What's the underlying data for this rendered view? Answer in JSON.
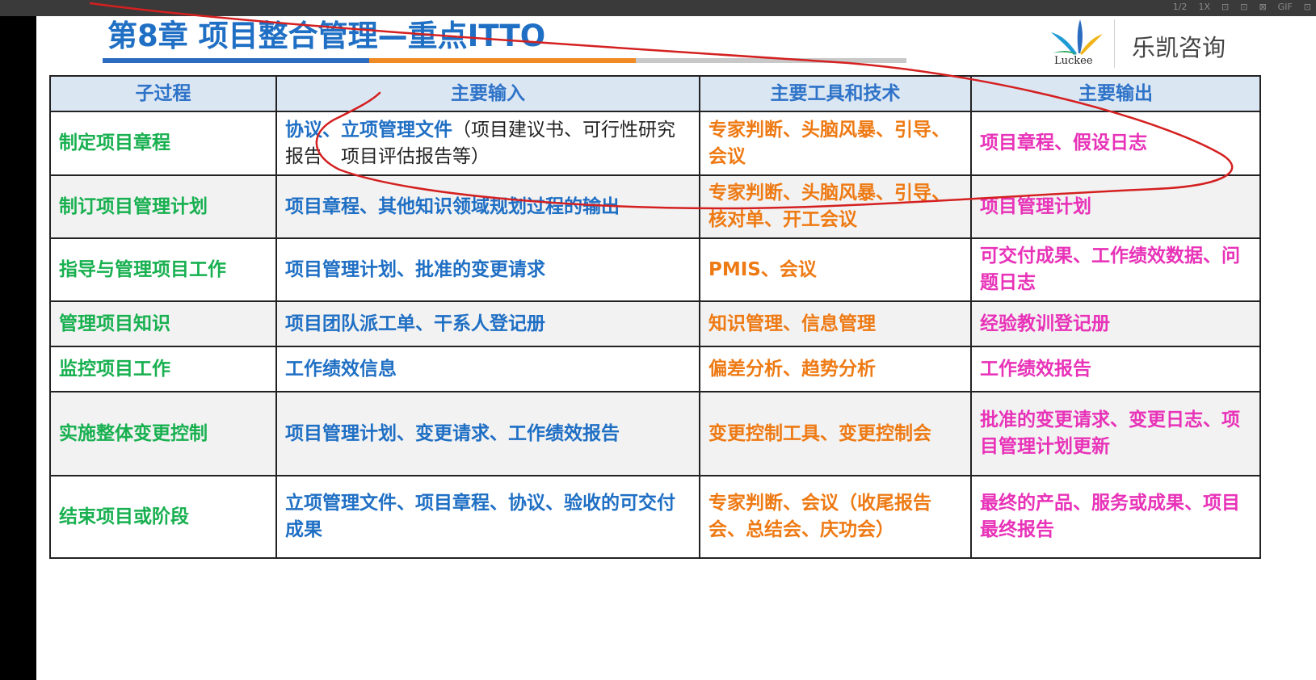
{
  "viewer": {
    "toolbar_icons": [
      "1/2",
      "1X",
      "⊡",
      "⊡",
      "⊠",
      "GIF",
      "⊡"
    ]
  },
  "slide": {
    "title": "第8章 项目整合管理—重点ITTO",
    "logo": {
      "mark_text": "Luckee",
      "brand": "乐凯咨询"
    }
  },
  "table": {
    "headers": [
      "子过程",
      "主要输入",
      "主要工具和技术",
      "主要输出"
    ],
    "rows": [
      {
        "process": "制定项目章程",
        "inputs": "协议、立项管理文件",
        "inputs_note": "（项目建议书、可行性研究报告、项目评估报告等）",
        "tools": "专家判断、头脑风暴、引导、会议",
        "outputs": "项目章程、假设日志"
      },
      {
        "process": "制订项目管理计划",
        "inputs": "项目章程、其他知识领域规划过程的输出",
        "tools": "专家判断、头脑风暴、引导、核对单、开工会议",
        "outputs": "项目管理计划"
      },
      {
        "process": "指导与管理项目工作",
        "inputs": "项目管理计划、批准的变更请求",
        "tools": "PMIS、会议",
        "outputs": "可交付成果、工作绩效数据、问题日志"
      },
      {
        "process": "管理项目知识",
        "inputs": "项目团队派工单、干系人登记册",
        "tools": "知识管理、信息管理",
        "outputs": "经验教训登记册"
      },
      {
        "process": "监控项目工作",
        "inputs": "工作绩效信息",
        "tools": "偏差分析、趋势分析",
        "outputs": "工作绩效报告"
      },
      {
        "process": "实施整体变更控制",
        "inputs": "项目管理计划、变更请求、工作绩效报告",
        "tools": "变更控制工具、变更控制会",
        "outputs": "批准的变更请求、变更日志、项目管理计划更新"
      },
      {
        "process": "结束项目或阶段",
        "inputs": "立项管理文件、项目章程、协议、验收的可交付成果",
        "tools": "专家判断、会议（收尾报告会、总结会、庆功会）",
        "outputs": "最终的产品、服务或成果、项目最终报告"
      }
    ]
  },
  "colors": {
    "header_text": "#2e73c8",
    "process": "#18b050",
    "inputs": "#1f6fc4",
    "tools": "#ee7a14",
    "outputs": "#e832b8",
    "annotation": "#d42020"
  }
}
